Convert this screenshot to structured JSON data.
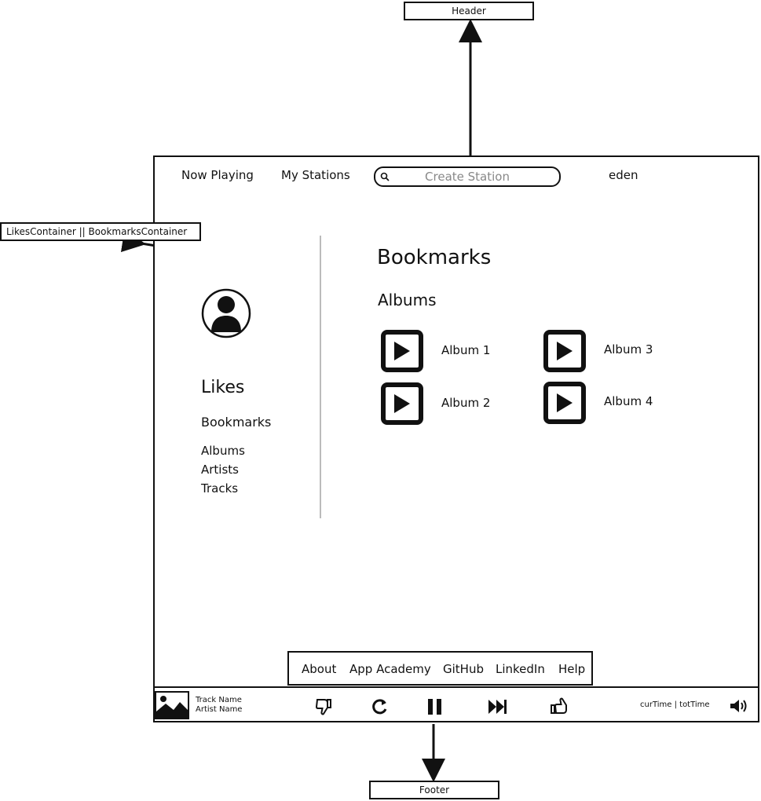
{
  "callouts": {
    "header": "Header",
    "likes": "LikesContainer || BookmarksContainer",
    "footer": "Footer"
  },
  "header": {
    "now_playing": "Now Playing",
    "my_stations": "My Stations",
    "search_placeholder": "Create Station",
    "username": "eden"
  },
  "sidebar": {
    "likes": "Likes",
    "bookmarks": "Bookmarks",
    "items": [
      "Albums",
      "Artists",
      "Tracks"
    ]
  },
  "main": {
    "title": "Bookmarks",
    "section": "Albums",
    "albums": [
      "Album 1",
      "Album 2",
      "Album 3",
      "Album 4"
    ]
  },
  "footer_links": [
    "About",
    "App Academy",
    "GitHub",
    "LinkedIn",
    "Help"
  ],
  "player": {
    "track_name": "Track Name",
    "artist_name": "Artist Name",
    "time": "curTime | totTime"
  }
}
